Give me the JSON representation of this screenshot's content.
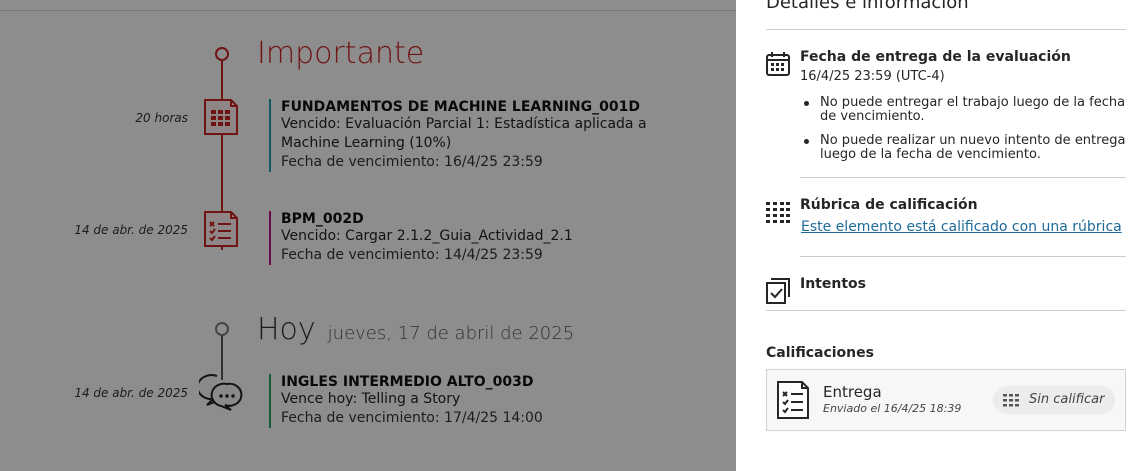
{
  "timeline": {
    "sections": [
      {
        "title": "Importante",
        "subtitle": ""
      },
      {
        "title": "Hoy",
        "subtitle": "jueves, 17 de abril de 2025"
      }
    ],
    "items": [
      {
        "time": "20 horas",
        "course": "FUNDAMENTOS DE MACHINE LEARNING_001D",
        "line1": "Vencido: Evaluación Parcial 1: Estadística aplicada a",
        "line2": "Machine Learning (10%)",
        "due": "Fecha de vencimiento: 16/4/25 23:59",
        "icon": "rubric-doc-icon",
        "accent": "#1a9bb0"
      },
      {
        "time": "14 de abr. de 2025",
        "course": "BPM_002D",
        "line1": "Vencido: Cargar 2.1.2_Guia_Actividad_2.1",
        "line2": "",
        "due": "Fecha de vencimiento: 14/4/25 23:59",
        "icon": "checklist-doc-icon",
        "accent": "#b0177a"
      },
      {
        "time": "14 de abr. de 2025",
        "course": "INGLES INTERMEDIO ALTO_003D",
        "line1": "Vence hoy: Telling a Story",
        "line2": "",
        "due": "Fecha de vencimiento: 17/4/25 14:00",
        "icon": "discussion-icon",
        "accent": "#27a05e"
      }
    ],
    "colors": {
      "important": "#c0231f",
      "today": "#555555"
    }
  },
  "panel": {
    "title": "Detalles e información",
    "due_section": {
      "heading": "Fecha de entrega de la evaluación",
      "date": "16/4/25 23:59 (UTC-4)",
      "bullets": [
        "No puede entregar el trabajo luego de la fecha de vencimiento.",
        "No puede realizar un nuevo intento de entrega luego de la fecha de vencimiento."
      ],
      "icon": "calendar-icon"
    },
    "rubric_section": {
      "heading": "Rúbrica de calificación",
      "link": "Este elemento está calificado con una rúbrica",
      "icon": "rubric-grid-icon"
    },
    "attempts_section": {
      "heading": "Intentos",
      "icon": "attempts-icon"
    },
    "grades": {
      "heading": "Calificaciones",
      "card": {
        "name": "Entrega",
        "sub": "Enviado el 16/4/25 18:39",
        "status": "Sin calificar",
        "icon": "checklist-doc-icon"
      }
    }
  }
}
